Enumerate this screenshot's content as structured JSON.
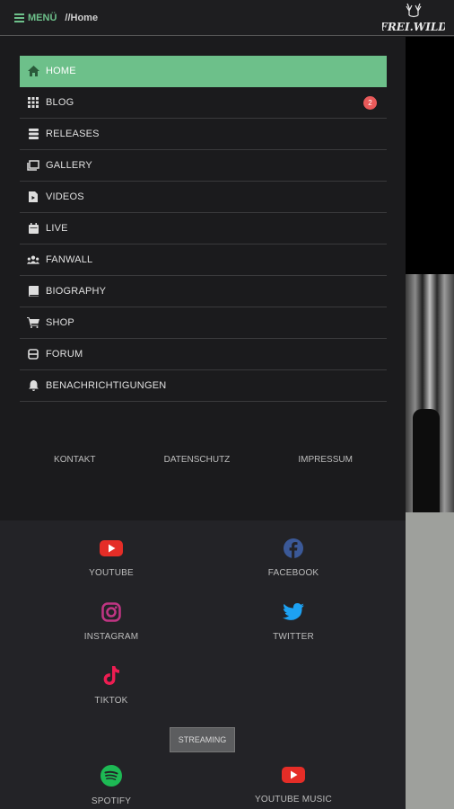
{
  "header": {
    "menu_label": "MENÜ",
    "breadcrumb": "//Home",
    "logo_text": "FREI.WILD"
  },
  "nav": {
    "items": [
      {
        "label": "HOME",
        "icon": "home-icon"
      },
      {
        "label": "BLOG",
        "icon": "grid-icon",
        "badge": "2"
      },
      {
        "label": "RELEASES",
        "icon": "stack-icon"
      },
      {
        "label": "GALLERY",
        "icon": "images-icon"
      },
      {
        "label": "VIDEOS",
        "icon": "video-file-icon"
      },
      {
        "label": "LIVE",
        "icon": "calendar-icon"
      },
      {
        "label": "FANWALL",
        "icon": "people-icon"
      },
      {
        "label": "BIOGRAPHY",
        "icon": "book-icon"
      },
      {
        "label": "SHOP",
        "icon": "cart-icon"
      },
      {
        "label": "FORUM",
        "icon": "forum-icon"
      },
      {
        "label": "BENACHRICHTIGUNGEN",
        "icon": "bell-icon"
      }
    ]
  },
  "footer": {
    "kontakt": "KONTAKT",
    "datenschutz": "DATENSCHUTZ",
    "impressum": "IMPRESSUM"
  },
  "social": {
    "youtube": "YOUTUBE",
    "facebook": "FACEBOOK",
    "instagram": "INSTAGRAM",
    "twitter": "TWITTER",
    "tiktok": "TIKTOK",
    "streaming": "STREAMING",
    "spotify": "SPOTIFY",
    "youtube_music": "YOUTUBE MUSIC"
  },
  "colors": {
    "accent": "#6dc08a",
    "badge": "#e95a5a",
    "youtube": "#e52d27",
    "facebook": "#3b5998",
    "instagram": "#c13584",
    "twitter": "#1da1f2",
    "tiktok": "#ee1d52",
    "spotify": "#1db954"
  }
}
